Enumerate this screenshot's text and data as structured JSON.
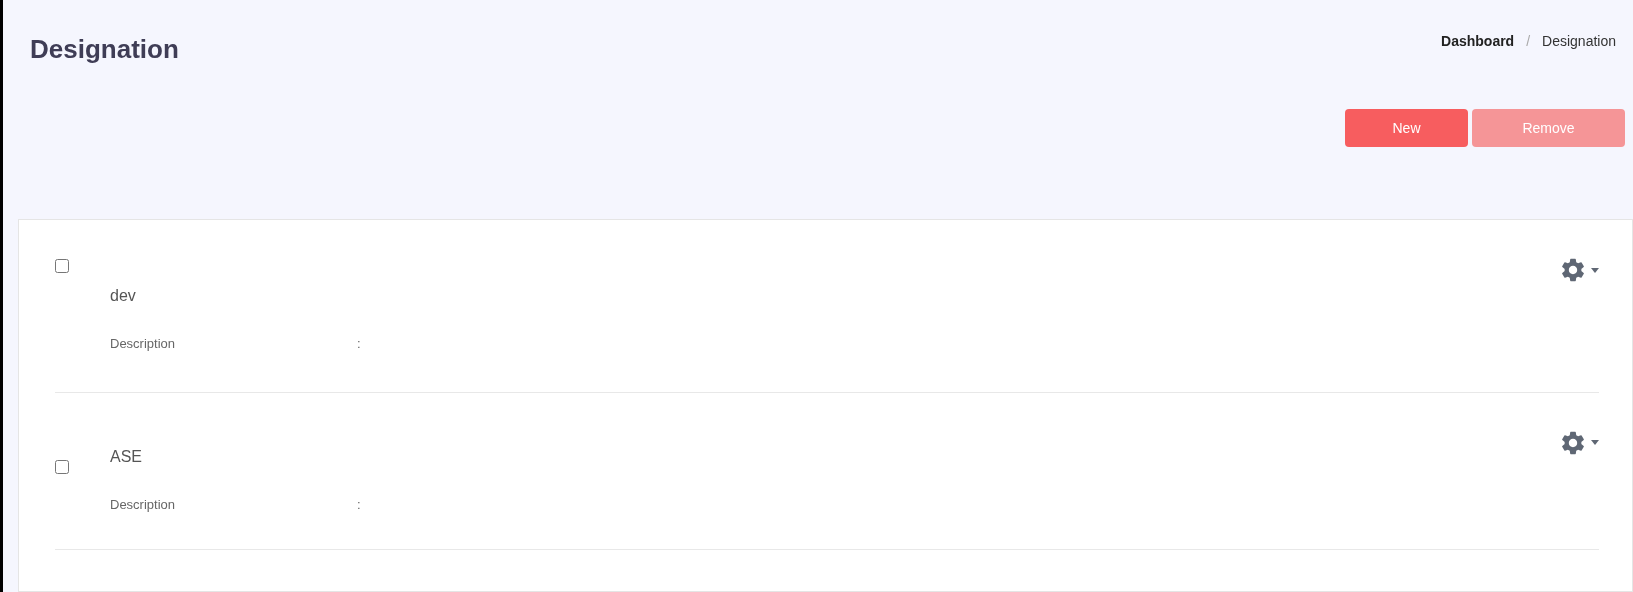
{
  "page_title": "Designation",
  "breadcrumb": [
    {
      "label": "Dashboard",
      "current": false
    },
    {
      "label": "Designation",
      "current": true
    }
  ],
  "breadcrumb_separator": "/",
  "buttons": [
    {
      "label": "New",
      "disabled": false
    },
    {
      "label": "Remove",
      "disabled": true
    }
  ],
  "records": [
    {
      "name": "dev",
      "checked": false,
      "fields": [
        {
          "label": "Description",
          "separator": ":"
        }
      ]
    },
    {
      "name": "ASE",
      "checked": false,
      "fields": [
        {
          "label": "Description",
          "separator": ":"
        }
      ]
    }
  ]
}
